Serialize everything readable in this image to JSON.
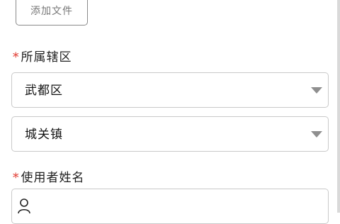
{
  "upload": {
    "add_file_label": "添加文件"
  },
  "district": {
    "required_mark": "*",
    "label": "所属辖区",
    "district_value": "武都区",
    "town_value": "城关镇"
  },
  "user_name": {
    "required_mark": "*",
    "label": "使用者姓名",
    "icon": "user-icon"
  },
  "colors": {
    "required": "#e0352b",
    "border": "#c9c9c9",
    "caret": "#8f8f8f"
  }
}
